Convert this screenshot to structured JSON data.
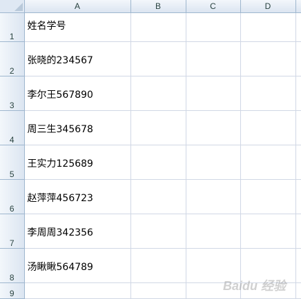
{
  "columns": [
    "A",
    "B",
    "C",
    "D"
  ],
  "rows": [
    {
      "num": "1",
      "a": "姓名学号"
    },
    {
      "num": "2",
      "a": "张晓的234567"
    },
    {
      "num": "3",
      "a": "李尔王567890"
    },
    {
      "num": "4",
      "a": "周三生345678"
    },
    {
      "num": "5",
      "a": "王实力125689"
    },
    {
      "num": "6",
      "a": "赵萍萍456723"
    },
    {
      "num": "7",
      "a": "李周周342356"
    },
    {
      "num": "8",
      "a": "汤瞅瞅564789"
    },
    {
      "num": "9",
      "a": ""
    }
  ],
  "watermark": "Baidu 经验"
}
